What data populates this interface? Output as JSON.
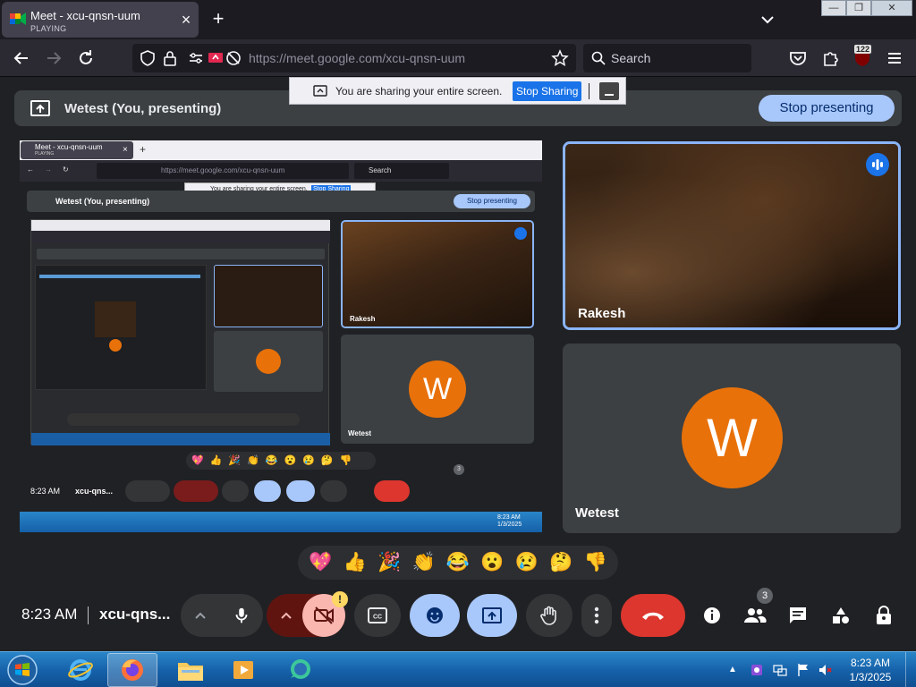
{
  "browser": {
    "tab_title": "Meet - xcu-qnsn-uum",
    "tab_status": "PLAYING",
    "url": "https://meet.google.com/xcu-qnsn-uum",
    "search_placeholder": "Search",
    "extension_badge": "122"
  },
  "share_notification": {
    "message": "You are sharing your entire screen.",
    "stop_label": "Stop Sharing"
  },
  "meet": {
    "presenting_title": "Wetest (You, presenting)",
    "stop_presenting_label": "Stop presenting",
    "tiles": [
      {
        "name": "Rakesh",
        "speaking": true
      },
      {
        "name": "Wetest",
        "avatar_letter": "W",
        "avatar_color": "#e8710a"
      }
    ],
    "reactions": [
      "💖",
      "👍",
      "🎉",
      "👏",
      "😂",
      "😮",
      "😢",
      "🤔",
      "👎"
    ],
    "time": "8:23 AM",
    "meeting_code": "xcu-qns...",
    "people_count": "3",
    "camera_warning": "!"
  },
  "shared_screen": {
    "tab_title": "Meet - xcu-qnsn-uum",
    "tab_status": "PLAYING",
    "url": "https://meet.google.com/xcu-qnsn-uum",
    "search_placeholder": "Search",
    "message": "You are sharing your entire screen.",
    "stop_label": "Stop Sharing",
    "presenting_title": "Wetest (You, presenting)",
    "stop_presenting_label": "Stop presenting",
    "tile_name_1": "Rakesh",
    "tile_name_2": "Wetest",
    "avatar_letter": "W",
    "time": "8:23 AM",
    "meeting_code": "xcu-qns...",
    "people_count": "3",
    "taskbar_time": "8:23 AM",
    "taskbar_date": "1/3/2025"
  },
  "taskbar": {
    "time": "8:23 AM",
    "date": "1/3/2025"
  },
  "colors": {
    "accent": "#a8c7fa",
    "hangup": "#dc362e",
    "avatar": "#e8710a",
    "stop_sharing_blue": "#1a73e8"
  }
}
